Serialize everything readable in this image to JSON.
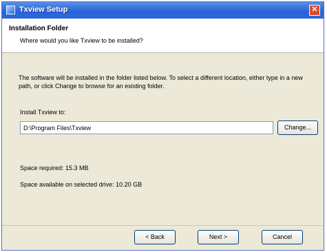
{
  "window": {
    "title": "Txview Setup",
    "close_glyph": "✕",
    "icons": {
      "app": "setup-app-icon",
      "close": "close-icon"
    }
  },
  "header": {
    "title": "Installation Folder",
    "subtitle": "Where would you like Txview to be installed?"
  },
  "main": {
    "description": "The software will be installed in the folder listed below. To select a different location, either type in a new path, or click Change to browse for an existing folder.",
    "install_label": "Install Txview to:",
    "install_path": "D:\\Program Files\\Txview",
    "change_label": "Change...",
    "space_required": "Space required: 15.3 MB",
    "space_available": "Space available on selected drive: 10.20 GB"
  },
  "footer": {
    "back_label": "< Back",
    "next_label": "Next >",
    "cancel_label": "Cancel"
  }
}
